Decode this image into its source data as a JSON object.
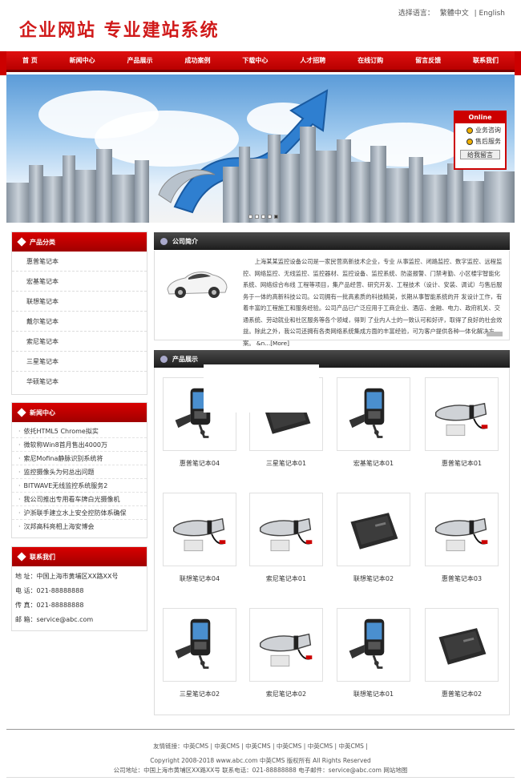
{
  "header": {
    "logo_text": "企业网站  专业建站系统",
    "lang_label": "选择语言：",
    "lang_options": [
      "繁體中文",
      "| English"
    ]
  },
  "nav": [
    "首 页",
    "新闻中心",
    "产品展示",
    "成功案例",
    "下载中心",
    "人才招聘",
    "在线订购",
    "留言反馈",
    "联系我们"
  ],
  "online_service": {
    "title": "Online service",
    "items": [
      "业务咨询",
      "售后服务"
    ],
    "message_button": "给我留言"
  },
  "sidebar": {
    "categories_title": "产品分类",
    "categories": [
      "惠普笔记本",
      "宏基笔记本",
      "联想笔记本",
      "戴尔笔记本",
      "索尼笔记本",
      "三星笔记本",
      "华硕笔记本"
    ],
    "news_title": "新闻中心",
    "news": [
      "依托HTML5 Chrome拟实",
      "微软称Win8首月售出4000万",
      "索尼Mofina静脉识别系统将",
      "监控摄像头为何总出问题",
      "BITWAVE无线监控系统服务2",
      "我公司推出专用看车牌白光摄像机",
      "沪浙联手建立水上安全控防体系确保",
      "汉邦高科亮相上海安博会"
    ],
    "contact_title": "联系我们",
    "contact": [
      "地  址：中国上海市黄埔区XX路XX号",
      "电  话：021-88888888",
      "传  真：021-88888888",
      "邮  箱：service@abc.com"
    ]
  },
  "about": {
    "title": "公司简介",
    "text": "上海某某监控设备公司是一家民营高新技术企业，专业 从事监控、闭路监控、数字监控、远程监控、网络监控、无线监控、监控器材、监控设备、监控系统、防盗报警、门禁考勤、小区楼宇智能化系统、网络综合布线 工程等项目，集产品经营、研究开发、工程技术（设计、安装、调试）与售后服务于一体的高新科技公司。公司拥有一批高素质的科技精英，长期从事智能系统的开 发设计工作，有着丰富的工程施工和服务经验。公司产品已广泛应用于工商企业、酒店、金融、电力、政府机关、交通系统、劳动就业和社区服务等各个领域，得到 了业内人士的一致认可和好评，取得了良好的社会效益。除此之外，我公司还拥有各类网络系统集成方面的丰富经验，可为客户提供各种一体化解决方案。",
    "more": "&n...[More]"
  },
  "products": {
    "title": "产品展示",
    "items": [
      {
        "name": "惠普笔记本04",
        "icon": "car-charger"
      },
      {
        "name": "三星笔记本01",
        "icon": "tablet-stand"
      },
      {
        "name": "宏基笔记本01",
        "icon": "car-charger"
      },
      {
        "name": "惠普笔记本01",
        "icon": "vacuum"
      },
      {
        "name": "联想笔记本04",
        "icon": "vacuum"
      },
      {
        "name": "索尼笔记本01",
        "icon": "vacuum"
      },
      {
        "name": "联想笔记本02",
        "icon": "tablet-stand"
      },
      {
        "name": "惠普笔记本03",
        "icon": "vacuum"
      },
      {
        "name": "三星笔记本02",
        "icon": "car-charger"
      },
      {
        "name": "索尼笔记本02",
        "icon": "vacuum"
      },
      {
        "name": "联想笔记本01",
        "icon": "car-charger"
      },
      {
        "name": "惠普笔记本02",
        "icon": "tablet-stand"
      }
    ]
  },
  "footer": {
    "links": "友情链接：中英CMS  |  中英CMS  |  中英CMS  |  中英CMS  |  中英CMS  |  中英CMS  |",
    "copyright": "Copyright 2008-2018 www.abc.com 中英CMS 版权所有  All Rights Reserved",
    "address": "公司地址：中国上海市黄埔区XX路XX号  联系电话：021-88888888 电子邮件：service@abc.com  网站地图"
  },
  "colors": {
    "brand_red": "#cc0000",
    "dark_header": "#2a2a2a"
  }
}
